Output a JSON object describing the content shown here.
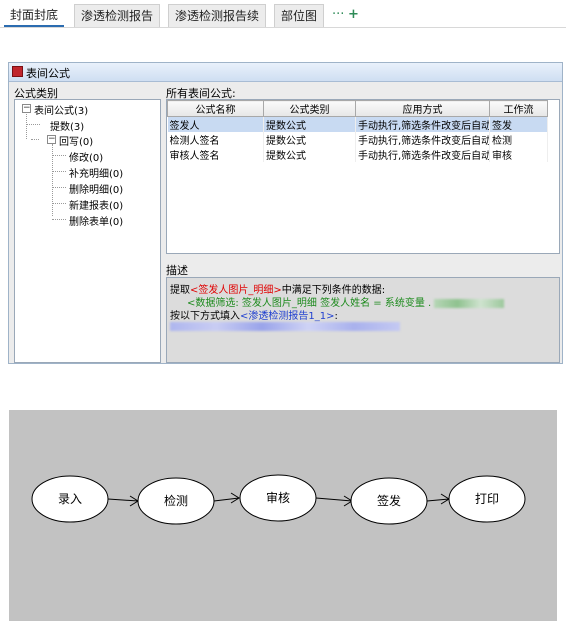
{
  "tabs": [
    {
      "label": "封面封底",
      "active": true
    },
    {
      "label": "渗透检测报告",
      "active": false
    },
    {
      "label": "渗透检测报告续",
      "active": false
    },
    {
      "label": "部位图",
      "active": false
    }
  ],
  "tab_extras": {
    "more": "···",
    "add": "+"
  },
  "dialog": {
    "title": "表间公式",
    "left_label": "公式类别",
    "right_label": "所有表间公式:",
    "desc_label": "描述"
  },
  "tree": {
    "root": "表间公式(3)",
    "child1": "提数(3)",
    "child2": "回写(0)",
    "grandchildren": [
      "修改(0)",
      "补充明细(0)",
      "删除明细(0)",
      "新建报表(0)",
      "删除表单(0)"
    ]
  },
  "grid": {
    "columns": [
      "公式名称",
      "公式类别",
      "应用方式",
      "工作流"
    ],
    "rows": [
      [
        "签发人",
        "提数公式",
        "手动执行,筛选条件改变后自动",
        "签发"
      ],
      [
        "检测人签名",
        "提数公式",
        "手动执行,筛选条件改变后自动",
        "检测"
      ],
      [
        "审核人签名",
        "提数公式",
        "手动执行,筛选条件改变后自动",
        "审核"
      ]
    ],
    "selected_row": 0
  },
  "description": {
    "l1_pre": "提取",
    "l1_ref": "<签发人图片_明细>",
    "l1_post": "中满足下列条件的数据:",
    "l2": "<数据筛选: 签发人图片_明细  签发人姓名 =  系统变量 .",
    "l3_pre": "按以下方式填入",
    "l3_ref": "<渗透检测报告1_1>",
    "l3_post": ":"
  },
  "flow": {
    "nodes": [
      "录入",
      "检测",
      "审核",
      "签发",
      "打印"
    ]
  },
  "colors": {
    "selected_row": "#c8daf2",
    "red_text": "#e00000",
    "green_text": "#1c8a1c",
    "blue_text": "#1f3fd0"
  }
}
